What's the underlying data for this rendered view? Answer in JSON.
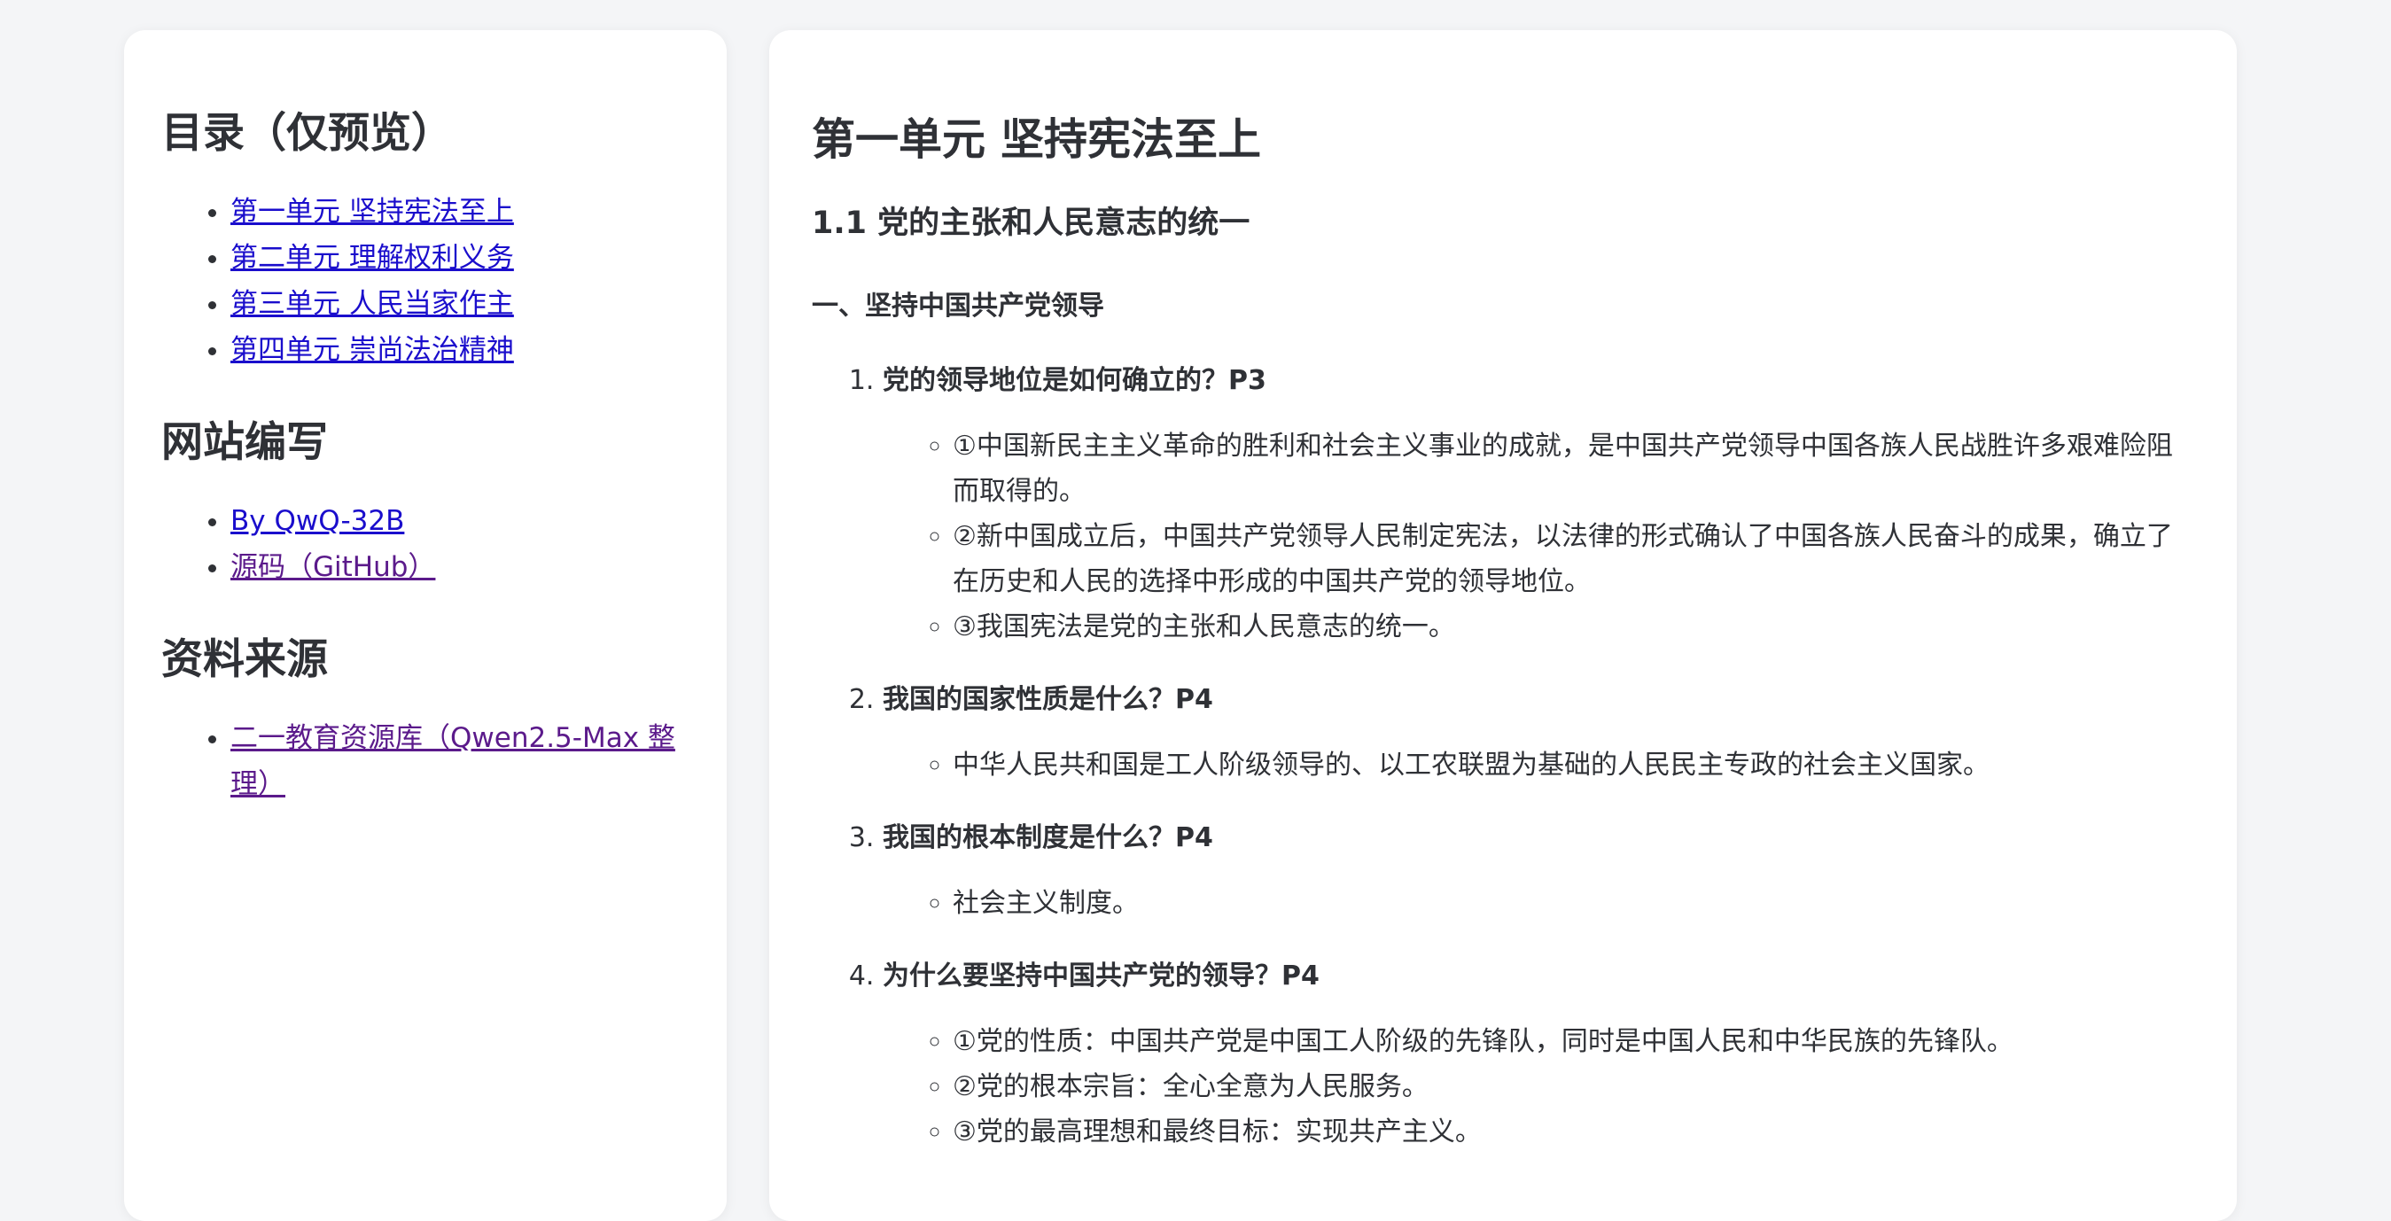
{
  "sidebar": {
    "toc_title": "目录（仅预览）",
    "toc_items": [
      "第一单元 坚持宪法至上",
      "第二单元 理解权利义务",
      "第三单元 人民当家作主",
      "第四单元 崇尚法治精神"
    ],
    "author_title": "网站编写",
    "author_items": [
      "By QwQ-32B",
      "源码（GitHub）"
    ],
    "source_title": "资料来源",
    "source_items": [
      "二一教育资源库（Qwen2.5-Max 整理）"
    ]
  },
  "main": {
    "unit_title": "第一单元 坚持宪法至上",
    "section_title": "1.1 党的主张和人民意志的统一",
    "subsection_title": "一、坚持中国共产党领导",
    "questions": [
      {
        "title": "党的领导地位是如何确立的？P3",
        "answers": [
          "①中国新民主主义革命的胜利和社会主义事业的成就，是中国共产党领导中国各族人民战胜许多艰难险阻而取得的。",
          "②新中国成立后，中国共产党领导人民制定宪法，以法律的形式确认了中国各族人民奋斗的成果，确立了在历史和人民的选择中形成的中国共产党的领导地位。",
          "③我国宪法是党的主张和人民意志的统一。"
        ]
      },
      {
        "title": "我国的国家性质是什么？P4",
        "answers": [
          "中华人民共和国是工人阶级领导的、以工农联盟为基础的人民民主专政的社会主义国家。"
        ]
      },
      {
        "title": "我国的根本制度是什么？P4",
        "answers": [
          "社会主义制度。"
        ]
      },
      {
        "title": "为什么要坚持中国共产党的领导？P4",
        "answers": [
          "①党的性质：中国共产党是中国工人阶级的先锋队，同时是中国人民和中华民族的先锋队。",
          "②党的根本宗旨：全心全意为人民服务。",
          "③党的最高理想和最终目标：实现共产主义。"
        ]
      }
    ]
  }
}
